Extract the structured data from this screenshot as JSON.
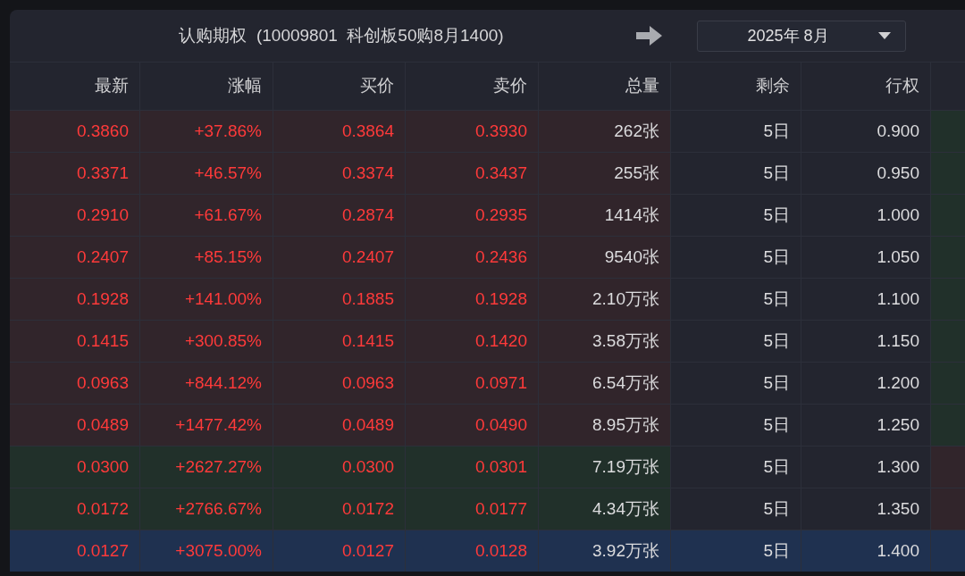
{
  "header": {
    "title": "认购期权  (10009801  科创板50购8月1400)",
    "month_dropdown": "2025年 8月"
  },
  "table": {
    "columns": [
      "最新",
      "涨幅",
      "买价",
      "卖价",
      "总量",
      "剩余",
      "行权"
    ],
    "rows": [
      {
        "cells": [
          "0.3860",
          "+37.86%",
          "0.3864",
          "0.3930",
          "262张",
          "5日",
          "0.900"
        ],
        "kind": "in_the_money",
        "selected": false
      },
      {
        "cells": [
          "0.3371",
          "+46.57%",
          "0.3374",
          "0.3437",
          "255张",
          "5日",
          "0.950"
        ],
        "kind": "in_the_money",
        "selected": false
      },
      {
        "cells": [
          "0.2910",
          "+61.67%",
          "0.2874",
          "0.2935",
          "1414张",
          "5日",
          "1.000"
        ],
        "kind": "in_the_money",
        "selected": false
      },
      {
        "cells": [
          "0.2407",
          "+85.15%",
          "0.2407",
          "0.2436",
          "9540张",
          "5日",
          "1.050"
        ],
        "kind": "in_the_money",
        "selected": false
      },
      {
        "cells": [
          "0.1928",
          "+141.00%",
          "0.1885",
          "0.1928",
          "2.10万张",
          "5日",
          "1.100"
        ],
        "kind": "in_the_money",
        "selected": false
      },
      {
        "cells": [
          "0.1415",
          "+300.85%",
          "0.1415",
          "0.1420",
          "3.58万张",
          "5日",
          "1.150"
        ],
        "kind": "in_the_money",
        "selected": false
      },
      {
        "cells": [
          "0.0963",
          "+844.12%",
          "0.0963",
          "0.0971",
          "6.54万张",
          "5日",
          "1.200"
        ],
        "kind": "in_the_money",
        "selected": false
      },
      {
        "cells": [
          "0.0489",
          "+1477.42%",
          "0.0489",
          "0.0490",
          "8.95万张",
          "5日",
          "1.250"
        ],
        "kind": "in_the_money",
        "selected": false
      },
      {
        "cells": [
          "0.0300",
          "+2627.27%",
          "0.0300",
          "0.0301",
          "7.19万张",
          "5日",
          "1.300"
        ],
        "kind": "out_of_the_money",
        "selected": false
      },
      {
        "cells": [
          "0.0172",
          "+2766.67%",
          "0.0172",
          "0.0177",
          "4.34万张",
          "5日",
          "1.350"
        ],
        "kind": "out_of_the_money",
        "selected": false
      },
      {
        "cells": [
          "0.0127",
          "+3075.00%",
          "0.0127",
          "0.0128",
          "3.92万张",
          "5日",
          "1.400"
        ],
        "kind": "out_of_the_money",
        "selected": true
      }
    ]
  }
}
